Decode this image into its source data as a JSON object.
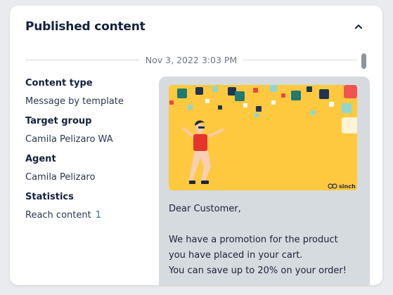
{
  "header": {
    "title": "Published content"
  },
  "timeline": {
    "timestamp": "Nov 3, 2022 3:03 PM"
  },
  "details": [
    {
      "label": "Content type",
      "value": "Message by template"
    },
    {
      "label": "Target group",
      "value": "Camila Pelizaro WA"
    },
    {
      "label": "Agent",
      "value": "Camila Pelizaro"
    },
    {
      "label": "Statistics",
      "value": "Reach content",
      "count": "1"
    }
  ],
  "message": {
    "brand_logo_text": "sinch",
    "banner_color": "#ffc93f",
    "bubble_color": "#d6dbe0",
    "lines": [
      "Dear Customer,",
      "",
      "We have a promotion for the product",
      "you have placed in your cart.",
      "You can save up to 20% on your order!"
    ]
  },
  "icons": {
    "collapse": "chevron-up-icon"
  }
}
